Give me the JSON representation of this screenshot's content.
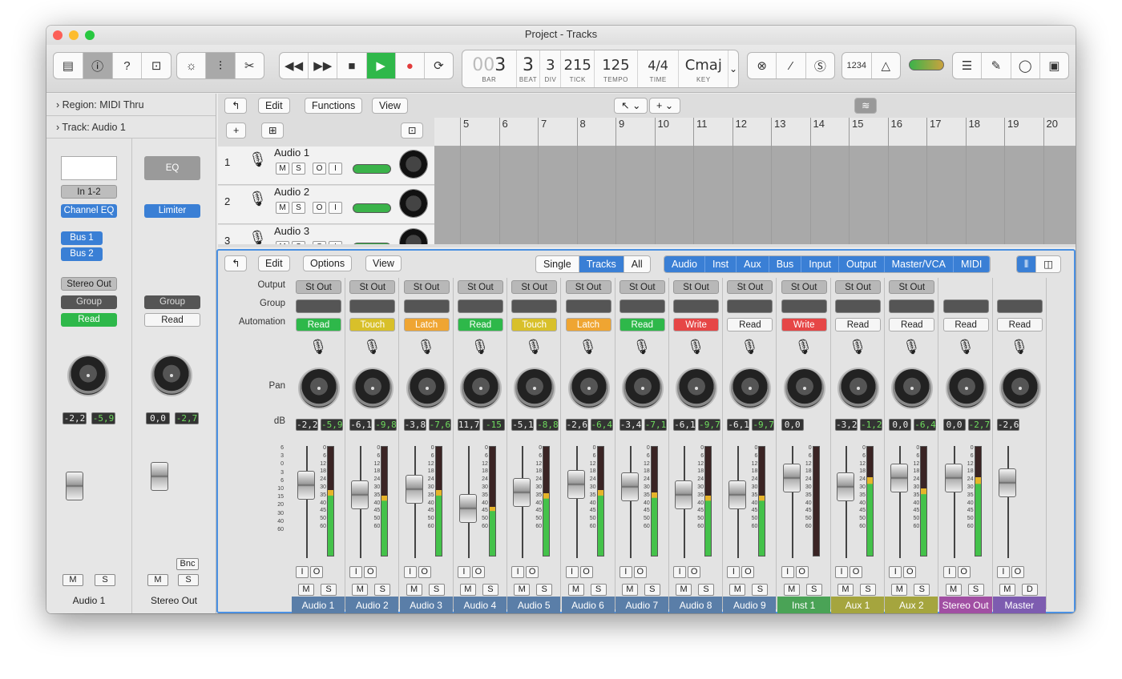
{
  "window": {
    "title": "Project - Tracks"
  },
  "lcd": {
    "bar_prefix": "00",
    "bar": "3",
    "beat": "3",
    "div": "3",
    "tick": "215",
    "tempo": "125",
    "time_num": "4",
    "time_den": "4",
    "key": "Cmaj",
    "bar_label": "BAR",
    "beat_label": "BEAT",
    "div_label": "DIV",
    "tick_label": "TICK",
    "tempo_label": "TEMPO",
    "time_label": "TIME",
    "key_label": "KEY"
  },
  "toolbar": {
    "counter_label": "1234"
  },
  "inspector": {
    "region": "Region: MIDI Thru",
    "track": "Track: Audio 1",
    "input": "In 1-2",
    "eq": "EQ",
    "plugin1": "Channel EQ",
    "plugin2": "Limiter",
    "bus1": "Bus 1",
    "bus2": "Bus 2",
    "output": "Stereo Out",
    "group": "Group",
    "group2": "Group",
    "auto1": "Read",
    "auto2": "Read",
    "db1a": "-2,2",
    "db1b": "-5,9",
    "db2a": "0,0",
    "db2b": "-2,7",
    "bnc": "Bnc",
    "name1": "Audio 1",
    "name2": "Stereo Out"
  },
  "tracks_menu": {
    "edit": "Edit",
    "functions": "Functions",
    "view": "View"
  },
  "ruler": [
    "5",
    "6",
    "7",
    "8",
    "9",
    "10",
    "11",
    "12",
    "13",
    "14",
    "15",
    "16",
    "17",
    "18",
    "19",
    "20"
  ],
  "track_list": [
    {
      "num": "1",
      "name": "Audio 1"
    },
    {
      "num": "2",
      "name": "Audio 2"
    },
    {
      "num": "3",
      "name": "Audio 3"
    }
  ],
  "mixer_menu": {
    "edit": "Edit",
    "options": "Options",
    "view": "View"
  },
  "mixer_views": [
    "Single",
    "Tracks",
    "All"
  ],
  "mixer_filters": [
    "Audio",
    "Inst",
    "Aux",
    "Bus",
    "Input",
    "Output",
    "Master/VCA",
    "MIDI"
  ],
  "row_labels": {
    "output": "Output",
    "group": "Group",
    "automation": "Automation",
    "pan": "Pan",
    "db": "dB"
  },
  "scale": [
    "0",
    "6",
    "12",
    "18",
    "24",
    "30",
    "35",
    "40",
    "45",
    "50",
    "60"
  ],
  "left_scale": [
    "6",
    "3",
    "0",
    "3",
    "6",
    "10",
    "15",
    "20",
    "30",
    "40",
    "60"
  ],
  "strips": [
    {
      "name": "Audio 1",
      "out": "St Out",
      "auto": "Read",
      "autoColor": "#2eb84a",
      "a": "-2,2",
      "b": "-5,9",
      "color": "#5a7ea8",
      "level": 0.6,
      "fader": 0.33
    },
    {
      "name": "Audio 2",
      "out": "St Out",
      "auto": "Touch",
      "autoColor": "#d8c02a",
      "a": "-6,1",
      "b": "-9,8",
      "color": "#5a7ea8",
      "level": 0.55,
      "fader": 0.45
    },
    {
      "name": "Audio 3",
      "out": "St Out",
      "auto": "Latch",
      "autoColor": "#efa532",
      "a": "-3,8",
      "b": "-7,6",
      "color": "#5a7ea8",
      "level": 0.6,
      "fader": 0.38
    },
    {
      "name": "Audio 4",
      "out": "St Out",
      "auto": "Read",
      "autoColor": "#2eb84a",
      "a": "11,7",
      "b": "-15",
      "color": "#5a7ea8",
      "level": 0.45,
      "fader": 0.62
    },
    {
      "name": "Audio 5",
      "out": "St Out",
      "auto": "Touch",
      "autoColor": "#d8c02a",
      "a": "-5,1",
      "b": "-8,8",
      "color": "#5a7ea8",
      "level": 0.57,
      "fader": 0.42
    },
    {
      "name": "Audio 6",
      "out": "St Out",
      "auto": "Latch",
      "autoColor": "#efa532",
      "a": "-2,6",
      "b": "-6,4",
      "color": "#5a7ea8",
      "level": 0.6,
      "fader": 0.32
    },
    {
      "name": "Audio 7",
      "out": "St Out",
      "auto": "Read",
      "autoColor": "#2eb84a",
      "a": "-3,4",
      "b": "-7,1",
      "color": "#5a7ea8",
      "level": 0.58,
      "fader": 0.35
    },
    {
      "name": "Audio 8",
      "out": "St Out",
      "auto": "Write",
      "autoColor": "#e64646",
      "a": "-6,1",
      "b": "-9,7",
      "color": "#5a7ea8",
      "level": 0.55,
      "fader": 0.45
    },
    {
      "name": "Audio 9",
      "out": "St Out",
      "auto": "Read",
      "autoColor": "#f6f6f6",
      "a": "-6,1",
      "b": "-9,7",
      "color": "#5a7ea8",
      "level": 0.55,
      "fader": 0.45
    },
    {
      "name": "Inst 1",
      "out": "St Out",
      "auto": "Write",
      "autoColor": "#e64646",
      "a": "0,0",
      "b": "",
      "color": "#4aa356",
      "level": 0.0,
      "fader": 0.24
    },
    {
      "name": "Aux 1",
      "out": "St Out",
      "auto": "Read",
      "autoColor": "#f6f6f6",
      "a": "-3,2",
      "b": "-1,2",
      "color": "#a5a53e",
      "level": 0.72,
      "fader": 0.35
    },
    {
      "name": "Aux 2",
      "out": "St Out",
      "auto": "Read",
      "autoColor": "#f6f6f6",
      "a": "0,0",
      "b": "-6,4",
      "color": "#a5a53e",
      "level": 0.62,
      "fader": 0.24
    },
    {
      "name": "Stereo Out",
      "out": "",
      "auto": "Read",
      "autoColor": "#f6f6f6",
      "a": "0,0",
      "b": "-2,7",
      "color": "#a14fa3",
      "level": 0.72,
      "fader": 0.24
    },
    {
      "name": "Master",
      "out": "",
      "auto": "Read",
      "autoColor": "#f6f6f6",
      "a": "-2,6",
      "b": "",
      "color": "#7d5cb0",
      "level": 0,
      "fader": 0.3
    }
  ]
}
